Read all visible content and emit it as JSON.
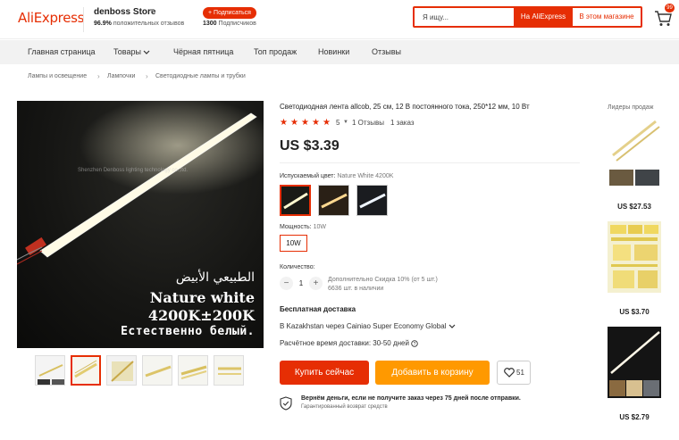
{
  "header": {
    "logo": "AliExpress",
    "store_name": "denboss Store",
    "positive_reviews_pct": "96.9%",
    "positive_reviews_label": "положительных отзывов",
    "subscribe_label": "+ Подписаться",
    "subscribers_count": "1300",
    "subscribers_label": "Подписчиков",
    "search_placeholder": "Я ищу...",
    "search_ali_label": "На AliExpress",
    "search_store_label": "В этом магазине",
    "cart_count": "99"
  },
  "nav": {
    "items": [
      "Главная страница",
      "Товары",
      "Чёрная пятница",
      "Топ продаж",
      "Новинки",
      "Отзывы"
    ]
  },
  "breadcrumb": [
    "Лампы и освещение",
    "Лампочки",
    "Светодиодные лампы и трубки"
  ],
  "gallery": {
    "watermark": "Shenzhen Denboss lighting technology co.,ltd.",
    "caption_arabic": "الطبيعي الأبيض",
    "caption_english": "Nature white",
    "caption_temp": "4200K±200K",
    "caption_russian": "Естественно белый.",
    "thumbnail_count": 6,
    "active_thumbnail": 2
  },
  "product": {
    "title": "Светодиодная лента allcob, 25 см, 12 В постоянного тока, 250*12 мм, 10 Вт",
    "rating": "5",
    "reviews": "1 Отзывы",
    "orders": "1 заказ",
    "price": "US $3.39",
    "color_label": "Испускаемый цвет:",
    "color_value": "Nature White 4200K",
    "power_label": "Мощность:",
    "power_value": "10W",
    "power_option": "10W",
    "quantity_label": "Количество:",
    "quantity": "1",
    "discount_note": "Дополнительно Скидка 10% (от 5 шт.)",
    "stock_note": "6636 шт. в наличии",
    "shipping_title": "Бесплатная доставка",
    "shipping_to": "В Kazakhstan через Cainiao Super Economy Global",
    "shipping_time": "Расчётное время доставки: 30-50 дней",
    "buy_now": "Купить сейчас",
    "add_to_cart": "Добавить в корзину",
    "wishlist_count": "51",
    "guarantee_1": "Вернём деньги, если не получите заказ через 75 дней после отправки.",
    "guarantee_2": "Гарантированный возврат средств"
  },
  "sidebar": {
    "title": "Лидеры продаж",
    "prices": [
      "US $27.53",
      "US $3.70",
      "US $2.79"
    ]
  },
  "colors": {
    "accent": "#e62e04",
    "cart_button": "#ff9900"
  }
}
